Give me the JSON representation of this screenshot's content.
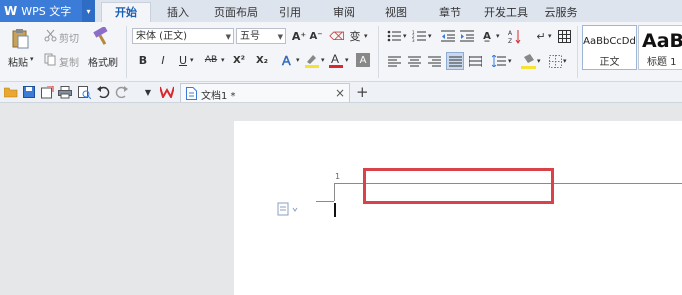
{
  "app": {
    "logo_mark": "W",
    "title": "WPS 文字",
    "dropdown_glyph": "▾"
  },
  "tabs": [
    {
      "label": "开始",
      "active": true
    },
    {
      "label": "插入",
      "active": false
    },
    {
      "label": "页面布局",
      "active": false
    },
    {
      "label": "引用",
      "active": false
    },
    {
      "label": "审阅",
      "active": false
    },
    {
      "label": "视图",
      "active": false
    },
    {
      "label": "章节",
      "active": false
    },
    {
      "label": "开发工具",
      "active": false
    },
    {
      "label": "云服务",
      "active": false
    }
  ],
  "clipboard": {
    "paste_label": "粘贴",
    "cut_label": "剪切",
    "copy_label": "复制",
    "format_painter_label": "格式刷"
  },
  "font": {
    "name": "宋体 (正文)",
    "size": "五号",
    "bold": "B",
    "italic": "I",
    "underline": "U",
    "strike": "AB",
    "superscript": "X²",
    "subscript": "X₂",
    "grow": "A⁺",
    "shrink": "A⁻",
    "phonetic": "变"
  },
  "styles": [
    {
      "preview": "AaBbCcDd",
      "label": "正文"
    },
    {
      "preview": "AaB",
      "label": "标题 1"
    }
  ],
  "document": {
    "tab_title": "文档1 *",
    "close_glyph": "×",
    "new_tab_glyph": "+",
    "line_number": "1"
  },
  "colors": {
    "accent": "#3b7cd9",
    "highlight_box": "#d9424a",
    "wps_red": "#d9292f"
  }
}
